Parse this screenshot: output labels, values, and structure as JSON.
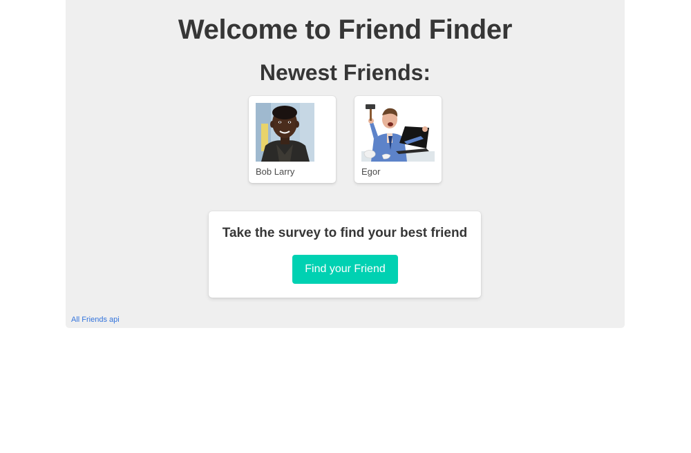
{
  "header": {
    "title": "Welcome to Friend Finder",
    "subtitle": "Newest Friends:"
  },
  "friends": [
    {
      "name": "Bob Larry",
      "photo": "smiling-boy-portrait"
    },
    {
      "name": "Egor",
      "photo": "angry-man-smashing-laptop"
    }
  ],
  "survey": {
    "prompt": "Take the survey to find your best friend",
    "button_label": "Find your Friend"
  },
  "footer": {
    "api_link": "All Friends api"
  },
  "colors": {
    "background": "#efefef",
    "accent": "#00d1b2",
    "link": "#3273dc",
    "text": "#363636"
  }
}
